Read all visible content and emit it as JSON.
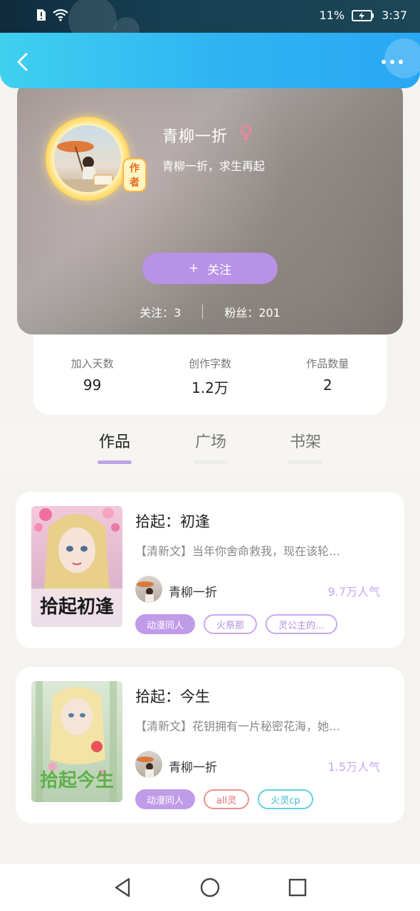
{
  "status_bar": {
    "battery": "11%",
    "time": "3:37"
  },
  "profile": {
    "author_tag": "作者",
    "name": "青柳一折",
    "gender": "♀",
    "bio": "青柳一折，求生再起",
    "follow_label": "关注",
    "follow_plus": "+",
    "following": "关注：3",
    "followers": "粉丝：201"
  },
  "stats": [
    {
      "label": "加入天数",
      "value": "99"
    },
    {
      "label": "创作字数",
      "value": "1.2万"
    },
    {
      "label": "作品数量",
      "value": "2"
    }
  ],
  "tabs": [
    {
      "label": "作品",
      "active": true
    },
    {
      "label": "广场",
      "active": false
    },
    {
      "label": "书架",
      "active": false
    }
  ],
  "books": [
    {
      "title": "拾起：初逢",
      "desc": "【清新文】当年你舍命救我，现在该轮…",
      "author": "青柳一折",
      "popularity": "9.7万人气",
      "cover_text": "拾起初逢",
      "tags": [
        "动漫同人",
        "火祭那",
        "灵公主的…"
      ]
    },
    {
      "title": "拾起：今生",
      "desc": "【清新文】花钥拥有一片秘密花海，她…",
      "author": "青柳一折",
      "popularity": "1.5万人气",
      "cover_text": "拾起今生",
      "tags": [
        "动漫同人",
        "all灵",
        "火灵cp"
      ]
    }
  ],
  "colors": {
    "header_start": "#3fd0ef",
    "header_end": "#29a7f4",
    "accent_purple": "#b892e6",
    "pop_purple": "#c6a6ee"
  },
  "icons": {
    "back": "chevron-left-icon",
    "more": "more-icon",
    "nav_back": "triangle-back-icon",
    "nav_home": "circle-home-icon",
    "nav_recent": "square-recent-icon"
  }
}
